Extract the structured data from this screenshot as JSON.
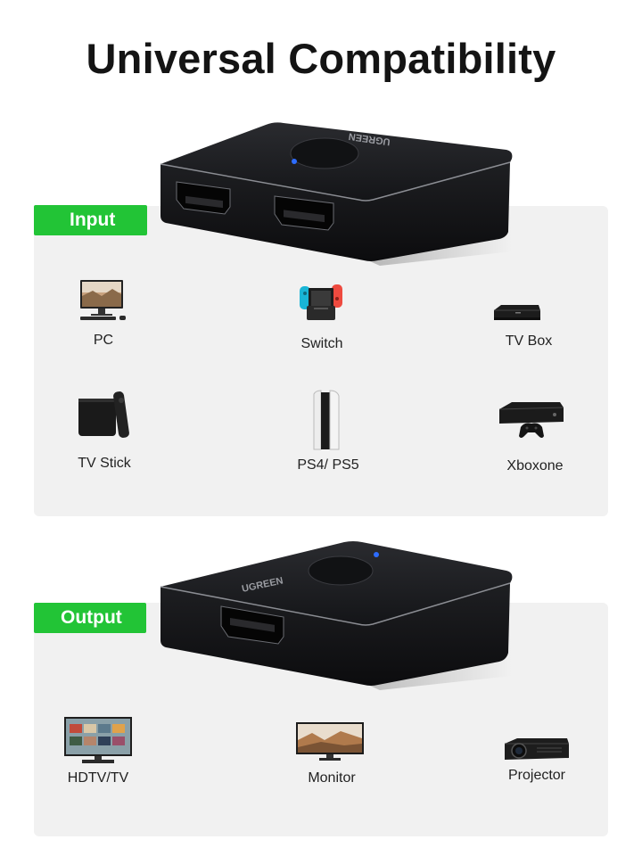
{
  "title": "Universal Compatibility",
  "brand": "UGREEN",
  "input": {
    "tag": "Input",
    "devices": [
      {
        "label": "PC",
        "icon": "pc-icon"
      },
      {
        "label": "Switch",
        "icon": "switch-console-icon"
      },
      {
        "label": "TV Box",
        "icon": "tv-box-icon"
      },
      {
        "label": "TV Stick",
        "icon": "tv-stick-icon"
      },
      {
        "label": "PS4/ PS5",
        "icon": "playstation-icon"
      },
      {
        "label": "Xboxone",
        "icon": "xbox-icon"
      }
    ]
  },
  "output": {
    "tag": "Output",
    "devices": [
      {
        "label": "HDTV/TV",
        "icon": "hdtv-icon"
      },
      {
        "label": "Monitor",
        "icon": "monitor-icon"
      },
      {
        "label": "Projector",
        "icon": "projector-icon"
      }
    ]
  },
  "colors": {
    "accent": "#22c436",
    "panel": "#f1f1f1",
    "device": "#1b1c1f",
    "led": "#2d6cff"
  }
}
